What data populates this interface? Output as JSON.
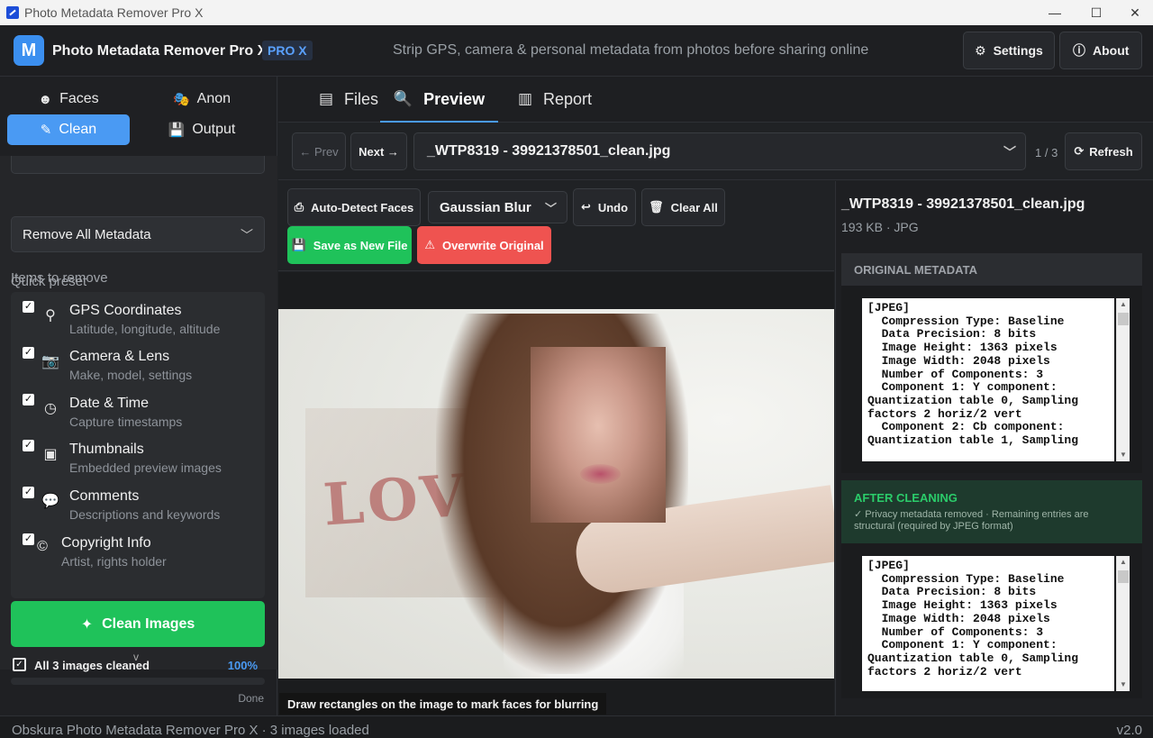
{
  "window": {
    "title": "Photo Metadata Remover Pro X",
    "controls": [
      "—",
      "☐",
      "✕"
    ]
  },
  "header": {
    "logo_letter": "M",
    "app_name": "Photo Metadata Remover Pro X",
    "badge": "PRO X",
    "tagline": "Strip GPS, camera & personal metadata from photos before sharing online",
    "settings_label": "Settings",
    "about_label": "About"
  },
  "sidebar": {
    "tabs": [
      {
        "label": "Faces",
        "icon": "face-icon",
        "active": false
      },
      {
        "label": "Anon",
        "icon": "mask-icon",
        "active": false
      },
      {
        "label": "Clean",
        "icon": "brush-icon",
        "active": true
      },
      {
        "label": "Output",
        "icon": "save-icon",
        "active": false
      }
    ],
    "quick_preset_label": "Quick preset",
    "quick_preset_value": "Remove All Metadata",
    "items_label": "Items to remove",
    "items": [
      {
        "name": "GPS Coordinates",
        "desc": "Latitude, longitude, altitude",
        "icon": "location-pin-icon",
        "checked": true
      },
      {
        "name": "Camera & Lens",
        "desc": "Make, model, settings",
        "icon": "camera-icon",
        "checked": true
      },
      {
        "name": "Date & Time",
        "desc": "Capture timestamps",
        "icon": "clock-icon",
        "checked": true
      },
      {
        "name": "Thumbnails",
        "desc": "Embedded preview images",
        "icon": "image-icon",
        "checked": true
      },
      {
        "name": "Comments",
        "desc": "Descriptions and keywords",
        "icon": "comment-icon",
        "checked": true
      },
      {
        "name": "Copyright Info",
        "desc": "Artist, rights holder",
        "icon": "copyright-icon",
        "checked": true
      }
    ],
    "more_indicator": "v",
    "clean_button": "Clean Images",
    "status_text": "All 3 images cleaned",
    "progress_percent": "100%",
    "progress_value": 1.0,
    "done_text": "Done"
  },
  "main": {
    "tabs": [
      {
        "label": "Files",
        "icon": "files-icon",
        "active": false
      },
      {
        "label": "Preview",
        "icon": "magnifier-icon",
        "active": true
      },
      {
        "label": "Report",
        "icon": "chart-icon",
        "active": false
      }
    ],
    "nav": {
      "prev_label": "← Prev",
      "next_label": "Next →",
      "file_name": "_WTP8319 - 39921378501_clean.jpg",
      "counter": "1 / 3",
      "refresh_label": "Refresh"
    },
    "toolbar": {
      "auto_detect": "Auto-Detect Faces",
      "blur_mode": "Gaussian Blur",
      "undo": "Undo",
      "clear_all": "Clear All",
      "save_new": "Save as New File",
      "overwrite": "Overwrite Original"
    },
    "canvas": {
      "poster_text": "LOV",
      "hint": "Draw rectangles on the image to mark faces for blurring"
    }
  },
  "right_panel": {
    "file_name": "_WTP8319 - 39921378501_clean.jpg",
    "file_meta": "193 KB  ·  JPG",
    "original_header": "ORIGINAL METADATA",
    "original_text": "[JPEG]\n  Compression Type: Baseline\n  Data Precision: 8 bits\n  Image Height: 1363 pixels\n  Image Width: 2048 pixels\n  Number of Components: 3\n  Component 1: Y component:\nQuantization table 0, Sampling\nfactors 2 horiz/2 vert\n  Component 2: Cb component:\nQuantization table 1, Sampling",
    "after_header": "AFTER CLEANING",
    "after_note": "✓ Privacy metadata removed  ·  Remaining entries are structural (required by JPEG format)",
    "after_text": "[JPEG]\n  Compression Type: Baseline\n  Data Precision: 8 bits\n  Image Height: 1363 pixels\n  Image Width: 2048 pixels\n  Number of Components: 3\n  Component 1: Y component:\nQuantization table 0, Sampling\nfactors 2 horiz/2 vert"
  },
  "statusbar": {
    "left": "Obskura Photo Metadata Remover Pro X  ·  3 images loaded",
    "right": "v2.0"
  },
  "colors": {
    "accent": "#4a9af3",
    "green": "#1fc25a",
    "red": "#ef5350",
    "background": "#202225"
  }
}
